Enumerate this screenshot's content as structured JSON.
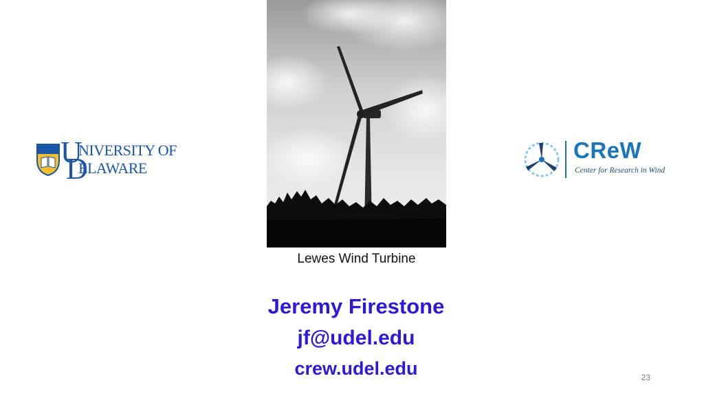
{
  "logos": {
    "left": {
      "university_line": "NIVERSITY OF",
      "delaware_line": "ELAWARE",
      "monogram_u": "U",
      "monogram_d": "D"
    },
    "right": {
      "acronym": "CReW",
      "full_name": "Center for Research in Wind"
    }
  },
  "photo": {
    "caption": "Lewes Wind Turbine"
  },
  "contact": {
    "name": "Jeremy Firestone",
    "email": "jf@udel.edu",
    "website": "crew.udel.edu"
  },
  "slide_number": "23",
  "colors": {
    "contact_text": "#2d1ad8",
    "ud_blue": "#1b55a8",
    "crew_blue": "#1b75bb"
  }
}
